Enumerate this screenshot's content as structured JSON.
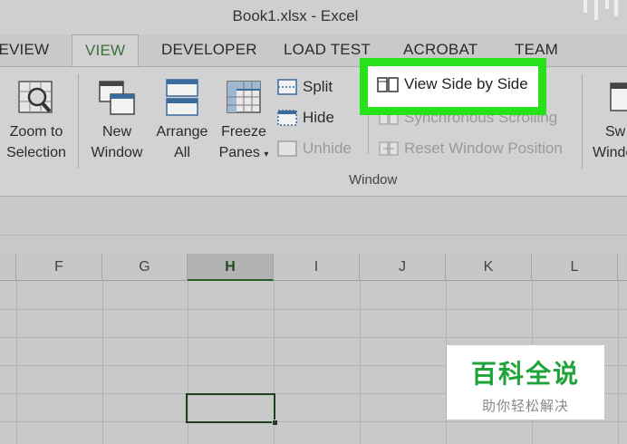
{
  "window": {
    "title": "Book1.xlsx - Excel"
  },
  "tabs": [
    "REVIEW",
    "VIEW",
    "DEVELOPER",
    "LOAD TEST",
    "ACROBAT",
    "TEAM"
  ],
  "active_tab": "VIEW",
  "ribbon": {
    "zoom_to_selection": {
      "line1": "Zoom to",
      "line2": "Selection"
    },
    "new_window": {
      "line1": "New",
      "line2": "Window"
    },
    "arrange_all": {
      "line1": "Arrange",
      "line2": "All"
    },
    "freeze_panes": {
      "line1": "Freeze",
      "line2": "Panes",
      "icon": "chevron-down-icon"
    },
    "split": "Split",
    "hide": "Hide",
    "unhide": "Unhide",
    "view_side_by_side": "View Side by Side",
    "synchronous_scrolling": "Synchronous Scrolling",
    "reset_window_position": "Reset Window Position",
    "switch_windows": {
      "line1": "Sw",
      "line2": "Windo"
    },
    "group_label": "Window"
  },
  "columns": [
    "F",
    "G",
    "H",
    "I",
    "J",
    "K",
    "L"
  ],
  "active_column": "H",
  "colors": {
    "highlight": "#27e21b",
    "active_tab_text": "#3b6f3b",
    "watermark_green": "#1fa33a"
  },
  "watermark": {
    "title": "百科全说",
    "subtitle": "助你轻松解决"
  }
}
